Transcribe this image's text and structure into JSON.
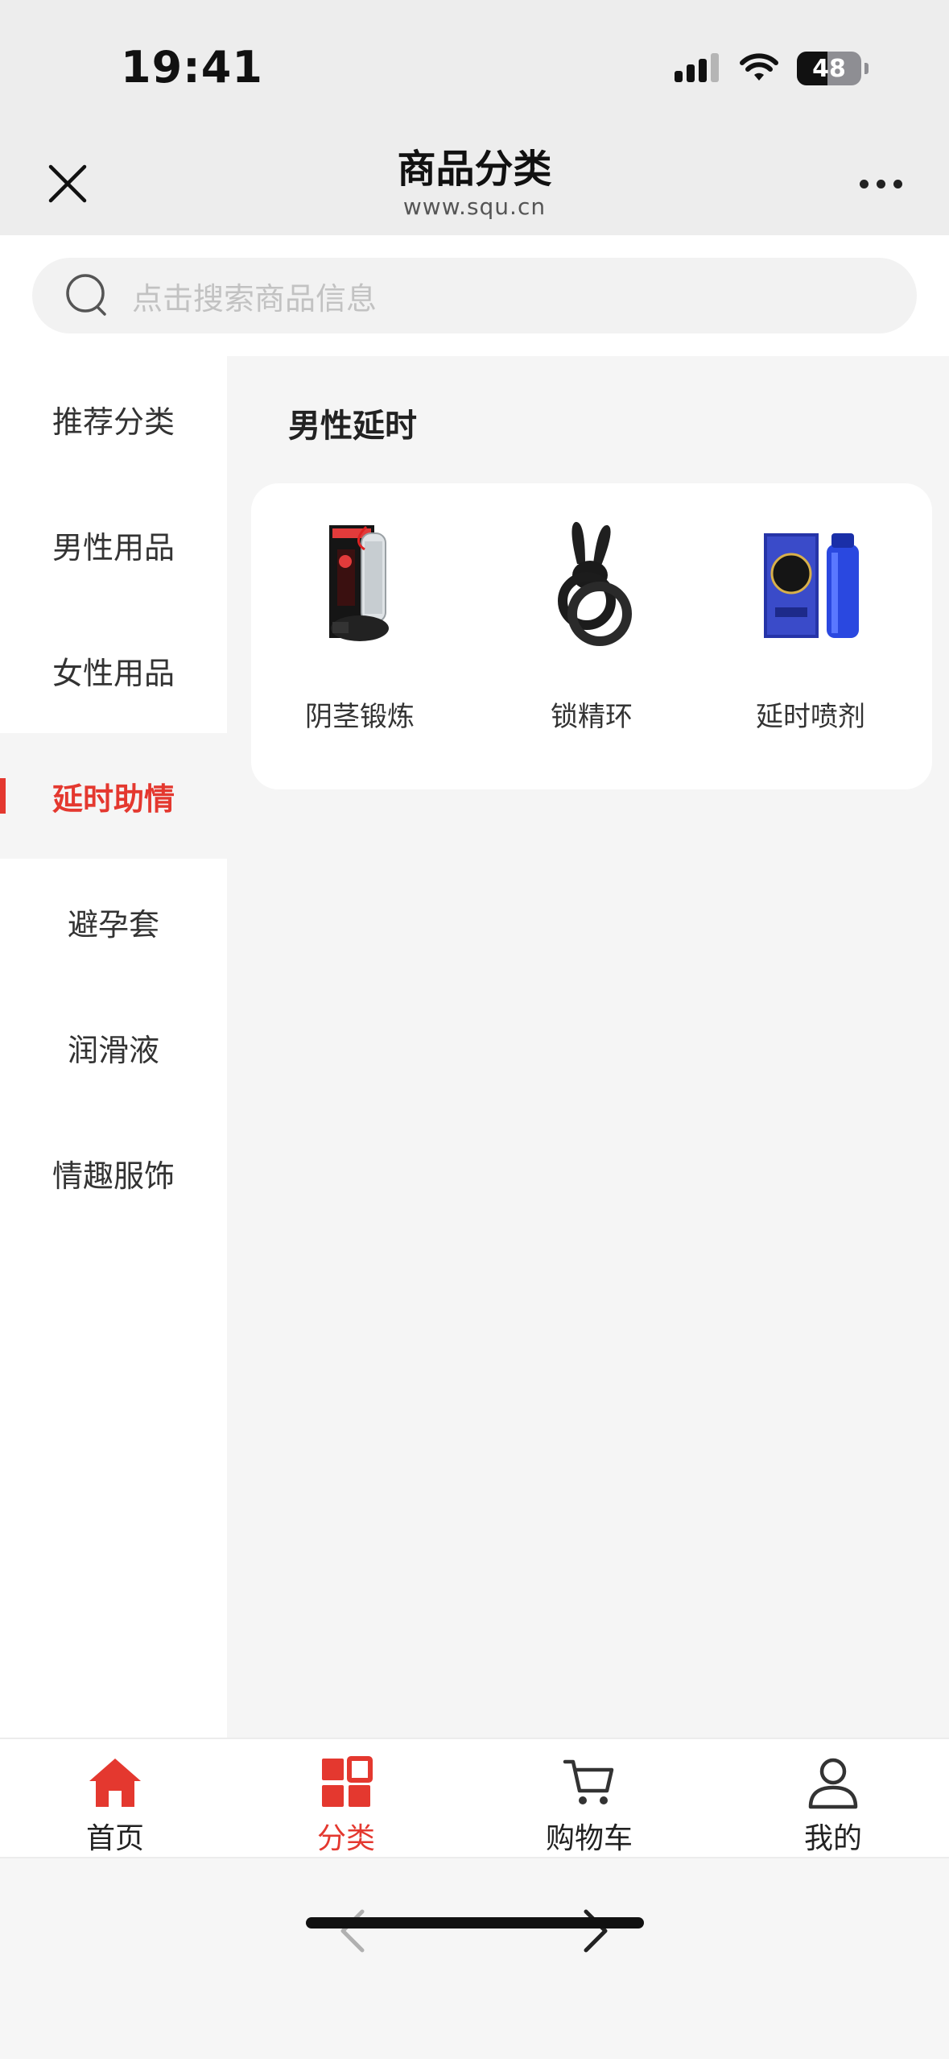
{
  "status": {
    "time": "19:41",
    "battery": "48"
  },
  "header": {
    "title": "商品分类",
    "subtitle": "www.squ.cn"
  },
  "search": {
    "placeholder": "点击搜索商品信息"
  },
  "sidebar": {
    "items": [
      {
        "label": "推荐分类"
      },
      {
        "label": "男性用品"
      },
      {
        "label": "女性用品"
      },
      {
        "label": "延时助情",
        "active": true
      },
      {
        "label": "避孕套"
      },
      {
        "label": "润滑液"
      },
      {
        "label": "情趣服饰"
      }
    ]
  },
  "content": {
    "section_title": "男性延时",
    "products": [
      {
        "label": "阴茎锻炼",
        "icon": "penis-pump-product-image"
      },
      {
        "label": "锁精环",
        "icon": "cock-ring-product-image"
      },
      {
        "label": "延时喷剂",
        "icon": "delay-spray-product-image"
      }
    ]
  },
  "tabbar": {
    "items": [
      {
        "label": "首页",
        "icon": "home-icon"
      },
      {
        "label": "分类",
        "icon": "category-grid-icon",
        "active": true
      },
      {
        "label": "购物车",
        "icon": "cart-icon"
      },
      {
        "label": "我的",
        "icon": "user-icon"
      }
    ]
  },
  "colors": {
    "accent": "#e4382f",
    "header_bg": "#ededed",
    "page_bg": "#f5f5f5"
  }
}
